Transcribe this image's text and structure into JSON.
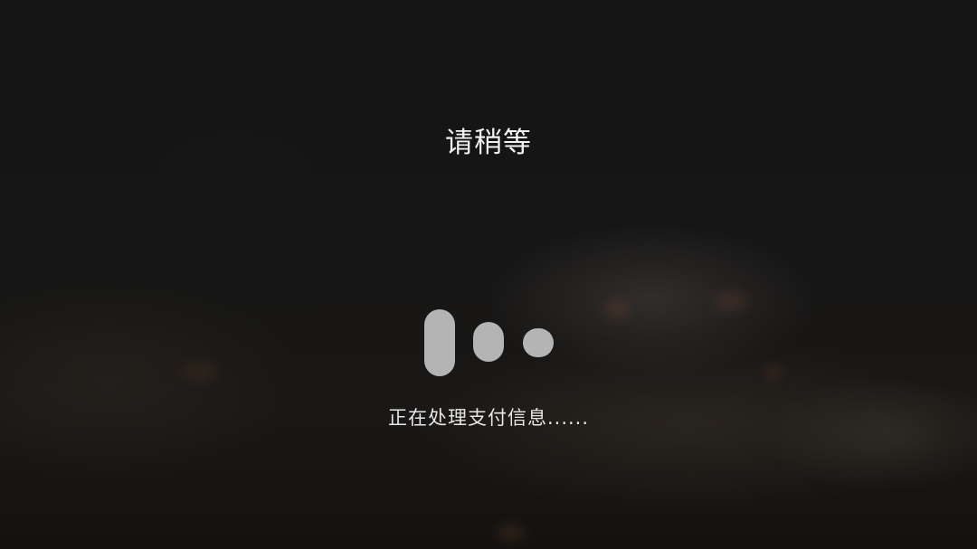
{
  "dialog": {
    "title": "请稍等",
    "message": "正在处理支付信息......"
  },
  "loader": {
    "icon": "loading-bars-icon",
    "color": "#b4b4b4"
  },
  "colors": {
    "background": "#141414",
    "text": "#f2f2f2"
  }
}
